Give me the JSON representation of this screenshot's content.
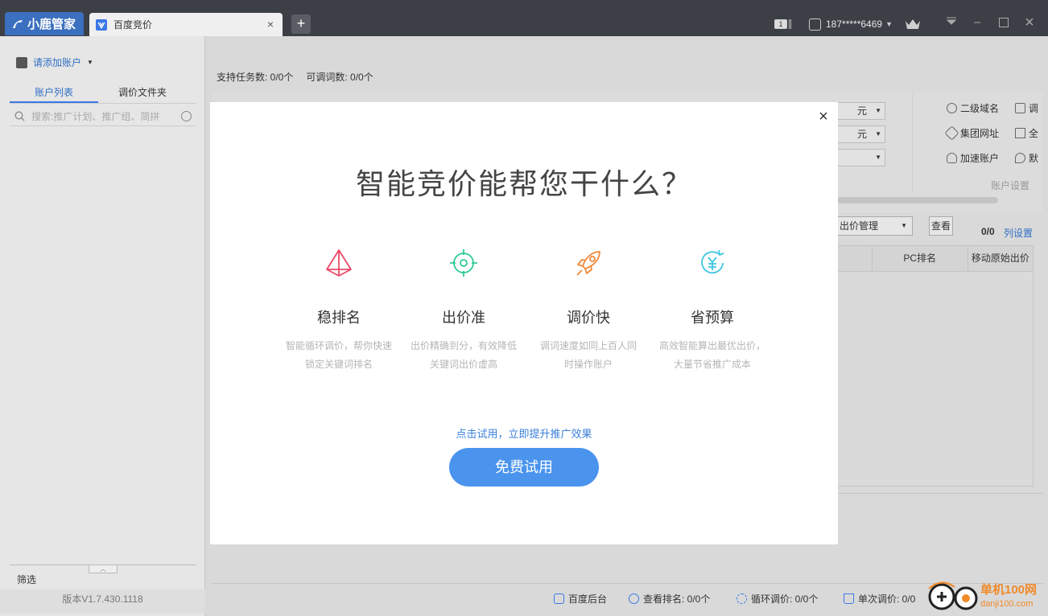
{
  "titlebar": {
    "app_name": "小鹿管家",
    "tab_label": "百度竞价",
    "new_tab": "+",
    "notif_badge": "1",
    "user_phone": "187*****6469"
  },
  "sidebar": {
    "add_account": "请添加账户",
    "tabs": [
      {
        "label": "账户列表"
      },
      {
        "label": "调价文件夹"
      }
    ],
    "search_placeholder": "搜索:推广计划、推广组、简拼",
    "filter": "筛选",
    "version": "版本V1.7.430.1118"
  },
  "main": {
    "supported_tasks": "支持任务数: 0/0个",
    "adjustable_words": "可调词数: 0/0个",
    "unit_select_1": "元",
    "unit_select_2": "元",
    "settings": [
      "二级域名",
      "集团网址",
      "加速账户"
    ],
    "settings_right": [
      "调",
      "全",
      "默"
    ],
    "account_settings": "账户设置",
    "bid_management": "出价管理",
    "view_button": "查看",
    "count": "0/0",
    "column_settings": "列设置",
    "table_headers": [
      "PC排名",
      "移动原始出价"
    ]
  },
  "statusbar": {
    "baidu_backend": "百度后台",
    "view_rank": "查看排名: 0/0个",
    "loop_bid": "循环调价: 0/0个",
    "single_bid": "单次调价: 0/0"
  },
  "watermark": {
    "text": "单机100网",
    "sub": "danji100.com"
  },
  "modal": {
    "title": "智能竞价能帮您干什么？",
    "features": [
      {
        "title": "稳排名",
        "desc1": "智能循环调价，帮你快速",
        "desc2": "锁定关键词排名",
        "icon": "pyramid-icon",
        "color": "#ec4a6a"
      },
      {
        "title": "出价准",
        "desc1": "出价精确到分，有效降低",
        "desc2": "关键词出价虚高",
        "icon": "crosshair-icon",
        "color": "#2ec99a"
      },
      {
        "title": "调价快",
        "desc1": "调词速度如同上百人同",
        "desc2": "时操作账户",
        "icon": "rocket-icon",
        "color": "#f0893a"
      },
      {
        "title": "省预算",
        "desc1": "高效智能算出最优出价，",
        "desc2": "大量节省推广成本",
        "icon": "yuan-refresh-icon",
        "color": "#3cc6e0"
      }
    ],
    "cta_hint": "点击试用，立即提升推广效果",
    "cta_button": "免费试用"
  }
}
